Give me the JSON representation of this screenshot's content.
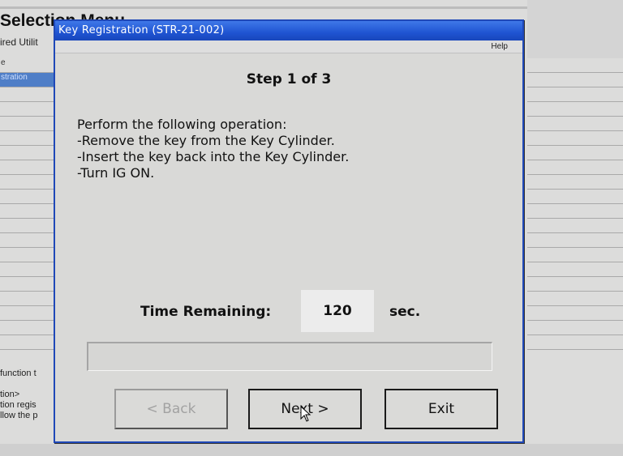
{
  "background": {
    "title": "Selection Menu",
    "subtitle": "ired Utilit",
    "list_items": [
      "e",
      "stration"
    ],
    "lower_text": [
      "function t",
      "",
      "tion>",
      "tion regis",
      "llow the p"
    ]
  },
  "dialog": {
    "title": "Key Registration (STR-21-002)",
    "menu_help": "Help",
    "step": "Step 1 of 3",
    "instructions": [
      "Perform the following operation:",
      "-Remove the key from the Key Cylinder.",
      "-Insert the key back into the Key Cylinder.",
      "-Turn IG ON."
    ],
    "time_label": "Time Remaining:",
    "time_value": "120",
    "time_unit": "sec.",
    "progress": 0,
    "buttons": {
      "back": "< Back",
      "next": "Next >",
      "exit": "Exit"
    }
  },
  "colors": {
    "titlebar": "#1f54d2",
    "selection": "#4f7ec7"
  }
}
